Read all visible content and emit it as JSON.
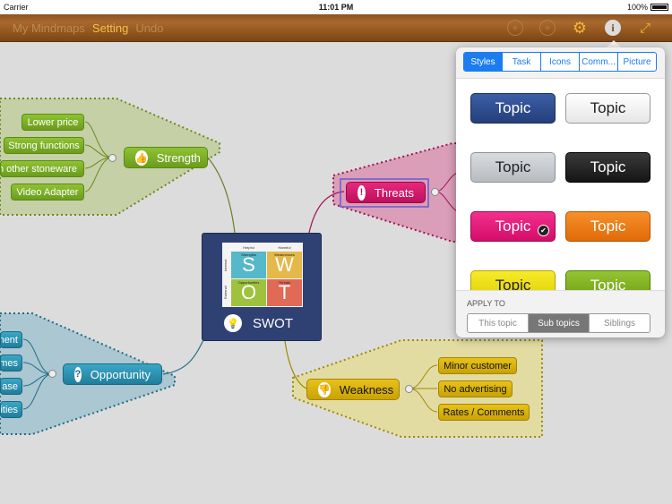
{
  "status_bar": {
    "carrier": "Carrier",
    "time": "11:01 PM",
    "battery": "100%"
  },
  "toolbar": {
    "my_mindmaps": "My Mindmaps",
    "setting": "Setting",
    "undo": "Undo",
    "icons": [
      "add-topic-icon",
      "add-subtopic-icon",
      "gear-icon",
      "info-icon",
      "expand-icon"
    ]
  },
  "mindmap": {
    "center": {
      "title": "SWOT",
      "grid": {
        "helpful": "Helpful",
        "harmful": "Harmful",
        "internal": "Internal",
        "external": "External",
        "strengths": "Strengths",
        "weaknesses": "Weaknesses",
        "opportunities": "Opportunities",
        "threats": "Threats",
        "s": "S",
        "w": "W",
        "o": "O",
        "t": "T"
      }
    },
    "strength": {
      "label": "Strength",
      "icon": "thumbs-up-icon",
      "children": [
        "Lower price",
        "Strong functions",
        "h other stoneware",
        "Video Adapter"
      ]
    },
    "threats": {
      "label": "Threats",
      "icon": "exclamation-icon"
    },
    "opportunity": {
      "label": "Opportunity",
      "icon": "question-icon",
      "children": [
        "ment",
        "mes",
        "ase",
        "ities"
      ]
    },
    "weakness": {
      "label": "Weakness",
      "icon": "thumbs-down-icon",
      "children": [
        "Minor customer",
        "No advertising",
        "Rates / Comments"
      ]
    }
  },
  "popover": {
    "tabs": [
      "Styles",
      "Task",
      "Icons",
      "Comm...",
      "Picture"
    ],
    "selected_tab": "Styles",
    "style_label": "Topic",
    "styles": [
      {
        "name": "blue",
        "color": "#2f4f8f"
      },
      {
        "name": "white",
        "color": "#ffffff"
      },
      {
        "name": "gray",
        "color": "#c5c9cc"
      },
      {
        "name": "black",
        "color": "#222222"
      },
      {
        "name": "pink",
        "color": "#e8157a",
        "selected": true
      },
      {
        "name": "orange",
        "color": "#f07a10"
      },
      {
        "name": "yellow",
        "color": "#f2de0a"
      },
      {
        "name": "green",
        "color": "#7fb21e"
      }
    ],
    "apply_to_label": "APPLY TO",
    "apply_options": [
      "This topic",
      "Sub topics",
      "Siblings"
    ],
    "apply_selected": "Sub topics"
  }
}
